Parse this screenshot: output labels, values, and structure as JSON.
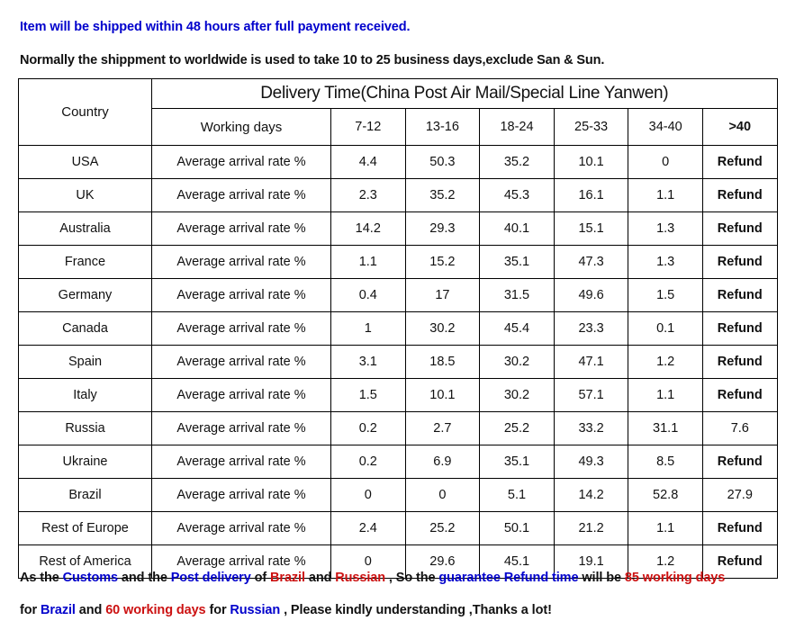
{
  "notices": {
    "line1": "Item will be shipped within 48 hours after full payment received.",
    "line2": "Normally the shippment to worldwide is used to take 10 to 25 business days,exclude San & Sun."
  },
  "table": {
    "country_header": "Country",
    "delivery_header": "Delivery Time(China Post Air Mail/Special Line Yanwen)",
    "working_days_header": "Working days",
    "day_ranges": [
      "7-12",
      "13-16",
      "18-24",
      "25-33",
      "34-40",
      ">40"
    ],
    "metric_label": "Average arrival rate %",
    "rows": [
      {
        "country": "USA",
        "values": [
          "4.4",
          "50.3",
          "35.2",
          "10.1",
          "0",
          "Refund"
        ]
      },
      {
        "country": "UK",
        "values": [
          "2.3",
          "35.2",
          "45.3",
          "16.1",
          "1.1",
          "Refund"
        ]
      },
      {
        "country": "Australia",
        "values": [
          "14.2",
          "29.3",
          "40.1",
          "15.1",
          "1.3",
          "Refund"
        ]
      },
      {
        "country": "France",
        "values": [
          "1.1",
          "15.2",
          "35.1",
          "47.3",
          "1.3",
          "Refund"
        ]
      },
      {
        "country": "Germany",
        "values": [
          "0.4",
          "17",
          "31.5",
          "49.6",
          "1.5",
          "Refund"
        ]
      },
      {
        "country": "Canada",
        "values": [
          "1",
          "30.2",
          "45.4",
          "23.3",
          "0.1",
          "Refund"
        ]
      },
      {
        "country": "Spain",
        "values": [
          "3.1",
          "18.5",
          "30.2",
          "47.1",
          "1.2",
          "Refund"
        ]
      },
      {
        "country": "Italy",
        "values": [
          "1.5",
          "10.1",
          "30.2",
          "57.1",
          "1.1",
          "Refund"
        ]
      },
      {
        "country": "Russia",
        "values": [
          "0.2",
          "2.7",
          "25.2",
          "33.2",
          "31.1",
          "7.6"
        ]
      },
      {
        "country": "Ukraine",
        "values": [
          "0.2",
          "6.9",
          "35.1",
          "49.3",
          "8.5",
          "Refund"
        ]
      },
      {
        "country": "Brazil",
        "values": [
          "0",
          "0",
          "5.1",
          "14.2",
          "52.8",
          "27.9"
        ]
      },
      {
        "country": "Rest of Europe",
        "values": [
          "2.4",
          "25.2",
          "50.1",
          "21.2",
          "1.1",
          "Refund"
        ]
      },
      {
        "country": "Rest of America",
        "values": [
          "0",
          "29.6",
          "45.1",
          "19.1",
          "1.2",
          "Refund"
        ]
      }
    ]
  },
  "footer": {
    "line1": [
      {
        "text": "As the ",
        "color": "black"
      },
      {
        "text": "Customs",
        "color": "blue"
      },
      {
        "text": " and the ",
        "color": "black"
      },
      {
        "text": "Post delivery",
        "color": "blue"
      },
      {
        "text": " of ",
        "color": "black"
      },
      {
        "text": "Brazil",
        "color": "red"
      },
      {
        "text": " and ",
        "color": "black"
      },
      {
        "text": "Russian",
        "color": "red"
      },
      {
        "text": " , So the ",
        "color": "black"
      },
      {
        "text": "guarantee Refund time",
        "color": "blue"
      },
      {
        "text": " will be ",
        "color": "black"
      },
      {
        "text": "85 working days",
        "color": "red"
      }
    ],
    "line2": [
      {
        "text": "for ",
        "color": "black"
      },
      {
        "text": "Brazil",
        "color": "blue"
      },
      {
        "text": " and ",
        "color": "black"
      },
      {
        "text": "60 working days",
        "color": "red"
      },
      {
        "text": " for ",
        "color": "black"
      },
      {
        "text": "Russian",
        "color": "blue"
      },
      {
        "text": " , Please kindly understanding ,Thanks a lot!",
        "color": "black"
      }
    ]
  },
  "colors": {
    "blue": "#0000CC",
    "red": "#CC1111",
    "black": "#111111",
    "border": "#000000",
    "background": "#FFFFFF"
  }
}
